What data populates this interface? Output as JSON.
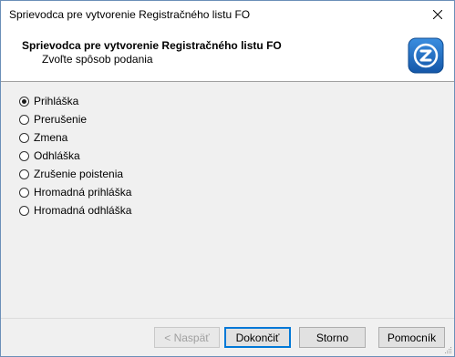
{
  "window": {
    "title": "Sprievodca pre vytvorenie Registračného listu FO"
  },
  "header": {
    "title": "Sprievodca pre vytvorenie Registračného listu FO",
    "subtitle": "Zvoľte spôsob podania"
  },
  "options": {
    "selected": "Prihláška",
    "items": [
      {
        "label": "Prihláška",
        "checked": true
      },
      {
        "label": "Prerušenie",
        "checked": false
      },
      {
        "label": "Zmena",
        "checked": false
      },
      {
        "label": "Odhláška",
        "checked": false
      },
      {
        "label": "Zrušenie poistenia",
        "checked": false
      },
      {
        "label": "Hromadná prihláška",
        "checked": false
      },
      {
        "label": "Hromadná odhláška",
        "checked": false
      }
    ]
  },
  "buttons": {
    "back": "< Naspäť",
    "finish": "Dokončiť",
    "cancel": "Storno",
    "help": "Pomocník"
  },
  "icons": {
    "close": "close-icon",
    "logo": "app-logo-icon",
    "grip": "resize-grip-icon"
  },
  "colors": {
    "logo_blue": "#1e6fbf",
    "default_button_border": "#0078d7"
  }
}
